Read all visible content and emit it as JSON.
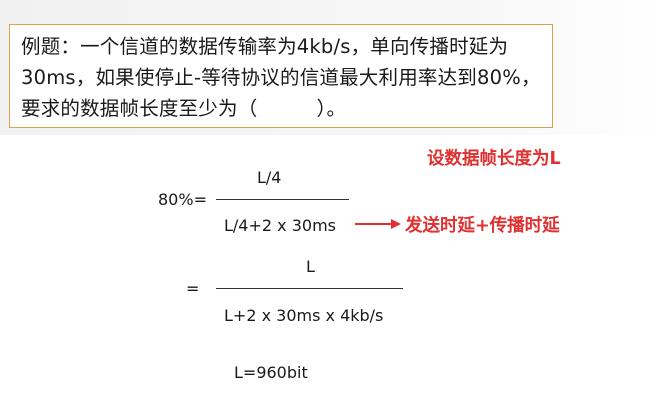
{
  "question": {
    "line1": "例题：一个信道的数据传输率为4kb/s，单向传播时延为",
    "line2": "30ms，如果使停止-等待协议的信道最大利用率达到80%，",
    "line3": "要求的数据帧长度至少为（　　　）。"
  },
  "notes": {
    "assume": "设数据帧长度为L",
    "delay": "发送时延+传播时延"
  },
  "formula1": {
    "lhs": "80%=",
    "numerator": "L/4",
    "denominator": "L/4+2 x 30ms"
  },
  "formula2": {
    "lhs": "=",
    "numerator": "L",
    "denominator": "L+2 x 30ms x 4kb/s"
  },
  "result": "L=960bit",
  "colors": {
    "note_red": "#e03030",
    "box_border": "#e0a050"
  }
}
